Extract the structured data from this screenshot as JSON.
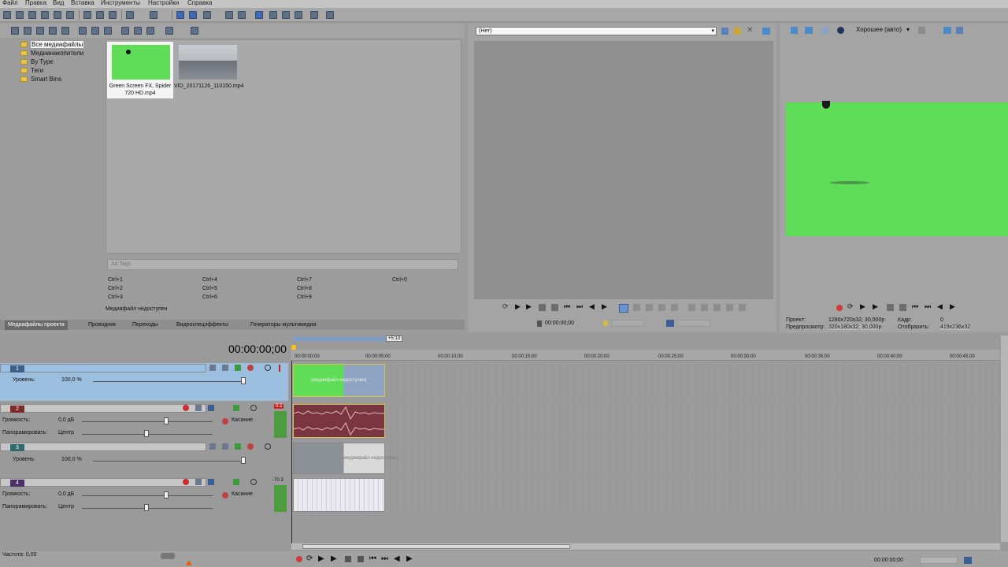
{
  "menu": [
    "Файл",
    "Правка",
    "Вид",
    "Вставка",
    "Инструменты",
    "Настройки",
    "Справка"
  ],
  "explorer": {
    "tree": [
      "Все медиафайлы",
      "Медианакопители",
      "By Type",
      "Теги",
      "Smart Bins"
    ],
    "media": [
      {
        "caption": "Green Screen FX, Spider 720 HD.mp4"
      },
      {
        "caption": "VID_20171126_110150.mp4"
      }
    ],
    "tag_placeholder": "Ad Tags",
    "shortcuts": [
      "Ctrl+1",
      "Ctrl+2",
      "Ctrl+3",
      "Ctrl+4",
      "Ctrl+5",
      "Ctrl+6",
      "Ctrl+7",
      "Ctrl+8",
      "Ctrl+9",
      "Ctrl+0"
    ],
    "status": "Медиафайл недоступен",
    "tabs": [
      "Медиафайлы проекта",
      "Проводник",
      "Переходы",
      "Видеоспецэффекты",
      "Генераторы мультимедиа"
    ]
  },
  "trimmer": {
    "select_value": "(Нет)",
    "time": "00:00:00;00"
  },
  "preview": {
    "quality": "Хорошее (авто)",
    "project_label": "Проект:",
    "project_value": "1280x720x32; 30,000р",
    "frame_label": "Кадр:",
    "frame_value": "0",
    "preview_label": "Предпросмотр:",
    "preview_value": "320x180x32; 30,000р",
    "display_label": "Отобразить:",
    "display_value": "419x236x32"
  },
  "timeline": {
    "timecode": "00:00:00;00",
    "loop_label": "+5:13",
    "ticks": [
      "00:00:00;00",
      "00:00:05;00",
      "00:00:10;00",
      "00:00:15;00",
      "00:00:20;00",
      "00:00:25;00",
      "00:00:30;00",
      "00:00:35;00",
      "00:00:40;00",
      "00:00:45;00"
    ],
    "tracks": [
      {
        "num": "1",
        "type": "video",
        "level_label": "Уровень:",
        "level_value": "100,0 %",
        "clip_text": "(медиафайл недоступен)"
      },
      {
        "num": "2",
        "type": "audio",
        "vol_label": "Громкость:",
        "vol_value": "0,0 дБ",
        "pan_label": "Панорамировать:",
        "pan_value": "Центр",
        "mode": "Касание",
        "peak": "0.2"
      },
      {
        "num": "3",
        "type": "video",
        "level_label": "Уровень:",
        "level_value": "100,0 %",
        "clip_text": "(медиафайл недоступен)"
      },
      {
        "num": "4",
        "type": "audio",
        "vol_label": "Громкость:",
        "vol_value": "0,0 дБ",
        "pan_label": "Панорамировать:",
        "pan_value": "Центр",
        "mode": "Касание",
        "peak": "-70.3"
      }
    ],
    "rate_label": "Частота: 0,00",
    "end_time": "00:00:00;00"
  }
}
